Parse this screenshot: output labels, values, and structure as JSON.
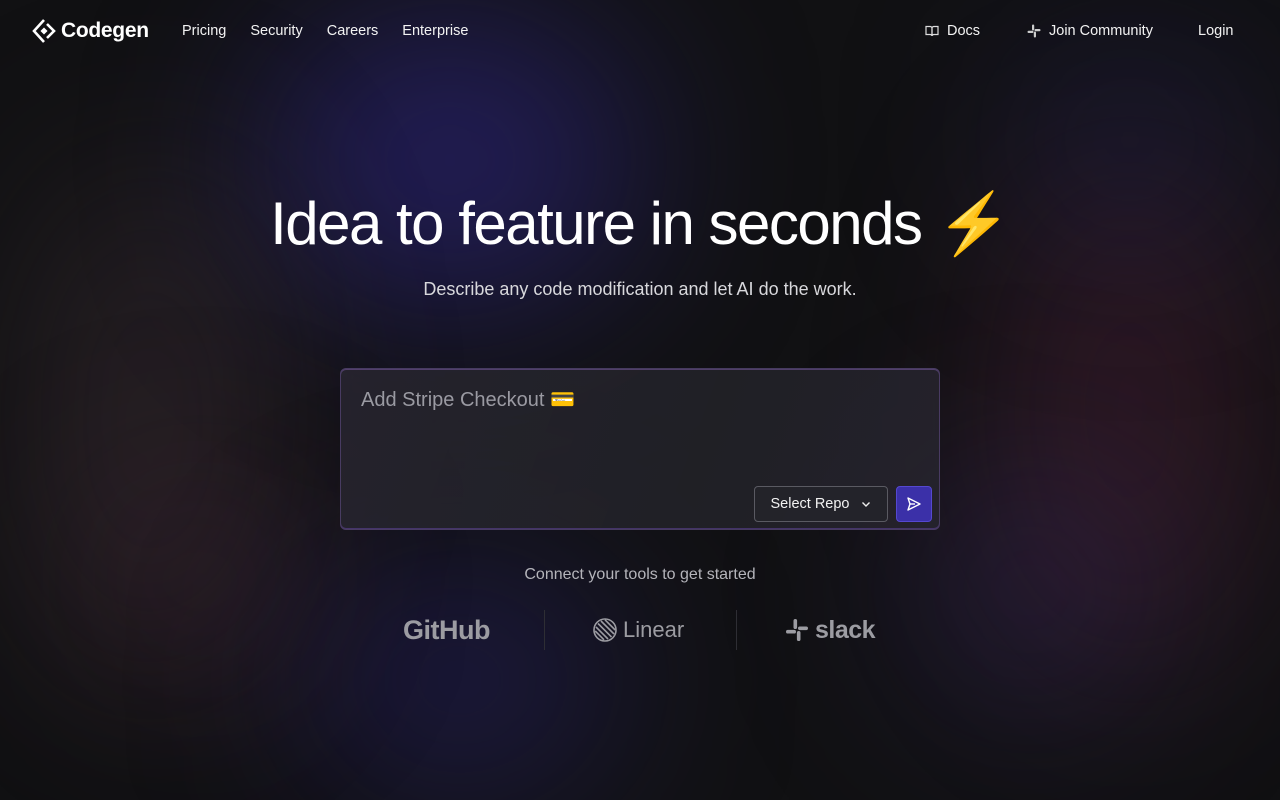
{
  "brand": {
    "name": "Codegen"
  },
  "nav": {
    "left": [
      {
        "label": "Pricing"
      },
      {
        "label": "Security"
      },
      {
        "label": "Careers"
      },
      {
        "label": "Enterprise"
      }
    ],
    "docs": {
      "label": "Docs",
      "icon": "book-icon"
    },
    "community": {
      "label": "Join Community",
      "icon": "slack-icon"
    },
    "login": {
      "label": "Login"
    }
  },
  "hero": {
    "title": "Idea to feature in seconds",
    "title_emoji": "⚡",
    "subtitle": "Describe any code modification and let AI do the work."
  },
  "prompt": {
    "placeholder": "Add Stripe Checkout 💳",
    "value": "",
    "select_repo_label": "Select Repo",
    "send_icon": "send-icon"
  },
  "integrations": {
    "heading": "Connect your tools to get started",
    "tools": [
      {
        "name": "GitHub"
      },
      {
        "name": "Linear"
      },
      {
        "name": "slack"
      }
    ]
  },
  "colors": {
    "background": "#111113",
    "accent": "#3b30a8",
    "bolt": "#f6c21a",
    "muted_text": "#9c9ca2"
  }
}
